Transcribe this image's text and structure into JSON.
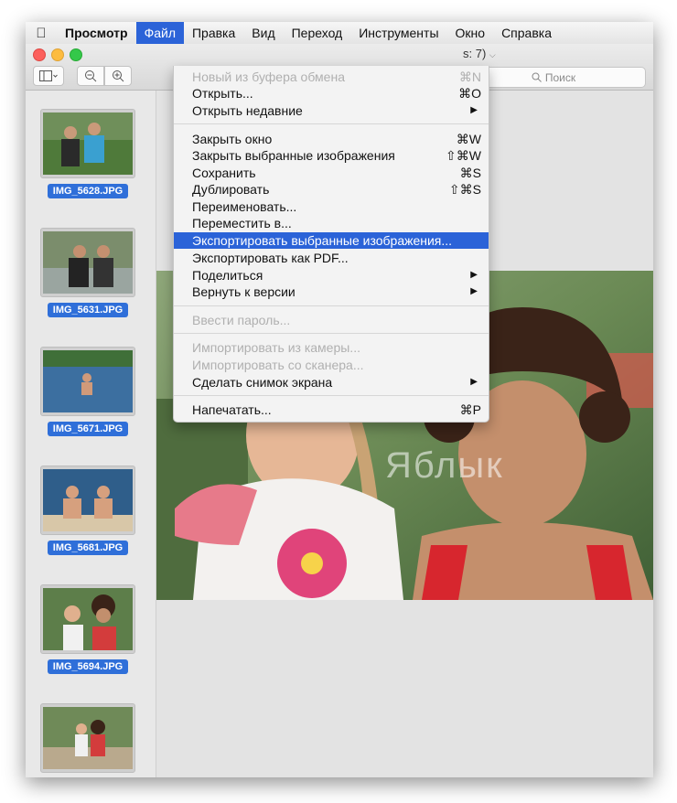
{
  "menubar": {
    "app": "Просмотр",
    "items": [
      "Файл",
      "Правка",
      "Вид",
      "Переход",
      "Инструменты",
      "Окно",
      "Справка"
    ]
  },
  "window": {
    "title_fragment": "s: 7)",
    "search_placeholder": "Поиск"
  },
  "file_menu": {
    "items": [
      {
        "label": "Новый из буфера обмена",
        "shortcut": "⌘N",
        "disabled": true
      },
      {
        "label": "Открыть...",
        "shortcut": "⌘O"
      },
      {
        "label": "Открыть недавние",
        "submenu": true
      },
      {
        "label": "Закрыть окно",
        "shortcut": "⌘W"
      },
      {
        "label": "Закрыть выбранные изображения",
        "shortcut": "⇧⌘W"
      },
      {
        "label": "Сохранить",
        "shortcut": "⌘S"
      },
      {
        "label": "Дублировать",
        "shortcut": "⇧⌘S"
      },
      {
        "label": "Переименовать..."
      },
      {
        "label": "Переместить в..."
      },
      {
        "label": "Экспортировать выбранные изображения...",
        "highlighted": true
      },
      {
        "label": "Экспортировать как PDF..."
      },
      {
        "label": "Поделиться",
        "submenu": true
      },
      {
        "label": "Вернуть к версии",
        "submenu": true
      },
      {
        "label": "Ввести пароль...",
        "disabled": true
      },
      {
        "label": "Импортировать из камеры...",
        "disabled": true
      },
      {
        "label": "Импортировать со сканера...",
        "disabled": true
      },
      {
        "label": "Сделать снимок экрана",
        "submenu": true
      },
      {
        "label": "Напечатать...",
        "shortcut": "⌘P"
      }
    ]
  },
  "thumbnails": [
    {
      "label": "IMG_5628.JPG"
    },
    {
      "label": "IMG_5631.JPG"
    },
    {
      "label": "IMG_5671.JPG"
    },
    {
      "label": "IMG_5681.JPG"
    },
    {
      "label": "IMG_5694.JPG"
    },
    {
      "label": ""
    }
  ],
  "watermark": "Яблык",
  "colors": {
    "accent": "#2b63d8",
    "selection": "#2f6fd9"
  }
}
